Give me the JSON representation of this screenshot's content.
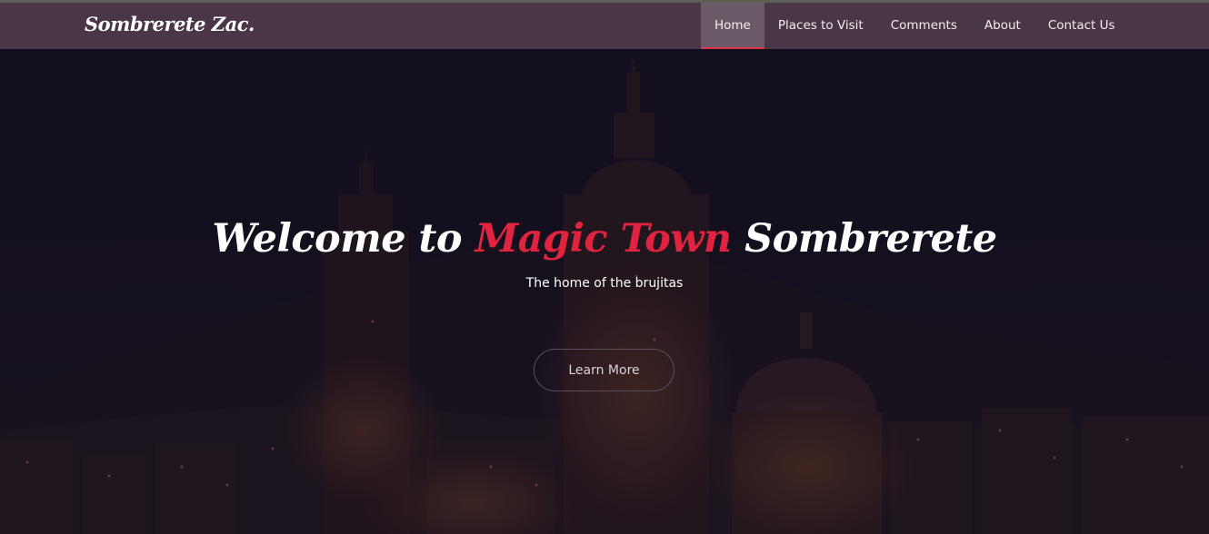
{
  "brand": {
    "name": "Sombrerete Zac."
  },
  "nav": {
    "items": [
      {
        "label": "Home",
        "active": true
      },
      {
        "label": "Places to Visit",
        "active": false
      },
      {
        "label": "Comments",
        "active": false
      },
      {
        "label": "About",
        "active": false
      },
      {
        "label": "Contact Us",
        "active": false
      }
    ]
  },
  "hero": {
    "title_start": "Welcome to ",
    "title_accent": "Magic Town",
    "title_end": " Sombrerete",
    "subtitle": "The home of the brujitas",
    "cta_label": "Learn More",
    "background_image": "night-cathedral-town"
  },
  "colors": {
    "accent": "#e0233e",
    "navbar": "#4a3646",
    "active_nav": "#6a5a68",
    "active_underline": "#e03448"
  }
}
